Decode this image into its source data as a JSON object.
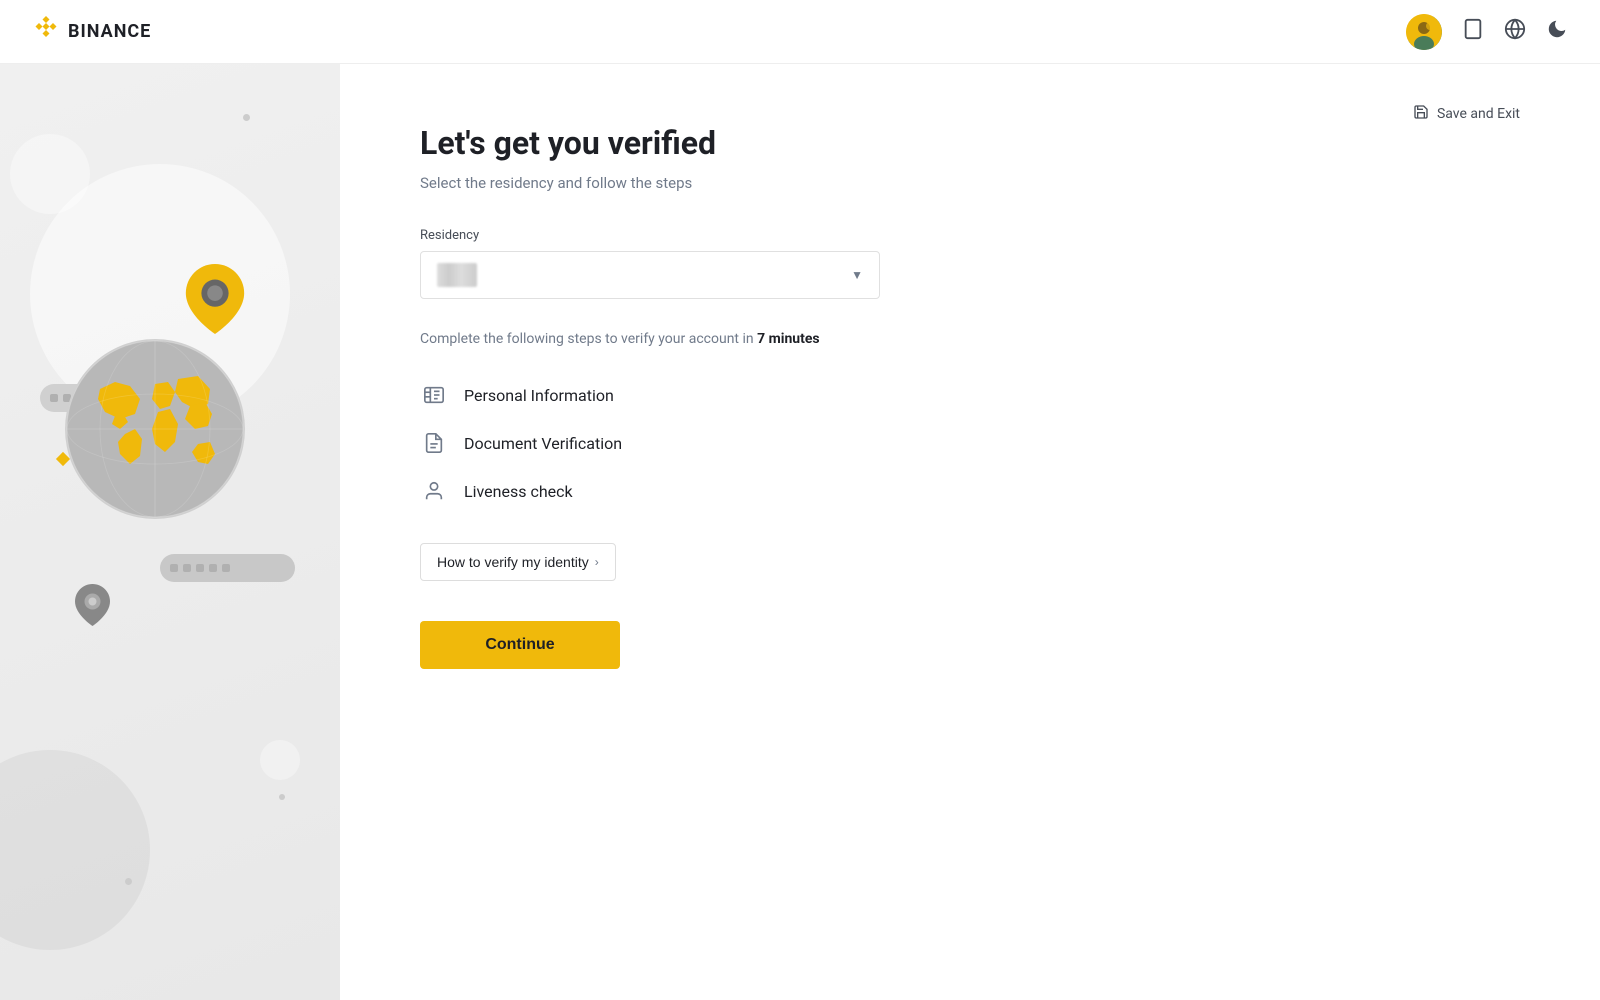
{
  "header": {
    "logo_text": "BINANCE",
    "logo_icon": "◆"
  },
  "save_exit": {
    "label": "Save and Exit",
    "icon": "🖫"
  },
  "content": {
    "title": "Let's get you verified",
    "subtitle": "Select the residency and follow the steps",
    "residency_label": "Residency",
    "residency_placeholder": "",
    "complete_prefix": "Complete the following steps to verify your account in ",
    "complete_time": "7 minutes",
    "steps": [
      {
        "label": "Personal Information",
        "icon": "id_card"
      },
      {
        "label": "Document Verification",
        "icon": "document"
      },
      {
        "label": "Liveness check",
        "icon": "person"
      }
    ],
    "how_to_label": "How to verify my identity",
    "continue_label": "Continue"
  }
}
